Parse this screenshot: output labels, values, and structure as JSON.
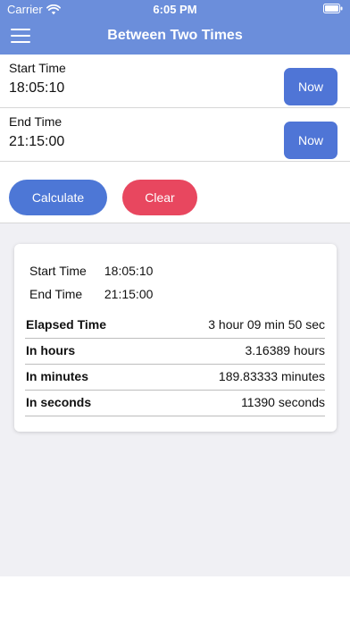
{
  "status_bar": {
    "carrier": "Carrier",
    "time": "6:05 PM"
  },
  "header": {
    "title": "Between Two Times"
  },
  "inputs": {
    "start": {
      "label": "Start Time",
      "value": "18:05:10",
      "button_label": "Now"
    },
    "end": {
      "label": "End Time",
      "value": "21:15:00",
      "button_label": "Now"
    }
  },
  "actions": {
    "calculate_label": "Calculate",
    "clear_label": "Clear"
  },
  "results": {
    "summary": [
      {
        "label": "Start Time",
        "value": "18:05:10"
      },
      {
        "label": "End Time",
        "value": "21:15:00"
      }
    ],
    "rows": [
      {
        "label": "Elapsed Time",
        "value": "3 hour 09 min 50 sec"
      },
      {
        "label": "In hours",
        "value": "3.16389 hours"
      },
      {
        "label": "In minutes",
        "value": "189.83333 minutes"
      },
      {
        "label": "In seconds",
        "value": "11390 seconds"
      }
    ]
  },
  "colors": {
    "header": "#6b8edb",
    "primary_button": "#4d77d6",
    "clear_button": "#e8475f",
    "background": "#f0f0f4"
  },
  "icons": {
    "menu": "menu-icon",
    "wifi": "wifi-icon",
    "battery": "battery-icon"
  }
}
